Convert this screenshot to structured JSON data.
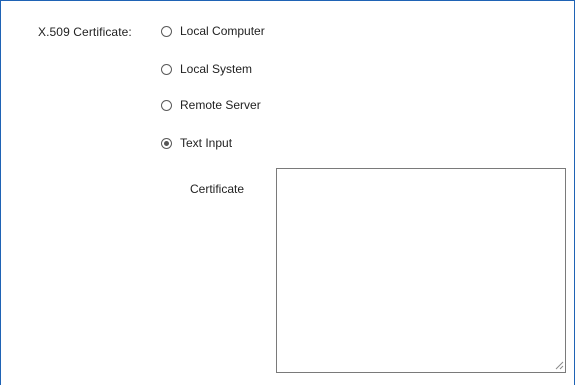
{
  "form": {
    "field_label": "X.509 Certificate:",
    "options": [
      {
        "label": "Local Computer",
        "selected": false
      },
      {
        "label": "Local System",
        "selected": false
      },
      {
        "label": "Remote Server",
        "selected": false
      },
      {
        "label": "Text Input",
        "selected": true
      }
    ],
    "certificate": {
      "label": "Certificate",
      "value": ""
    }
  },
  "colors": {
    "panel_border": "#1f63b5",
    "text": "#222222"
  },
  "icons": {
    "resize": "resize-grip-icon"
  }
}
